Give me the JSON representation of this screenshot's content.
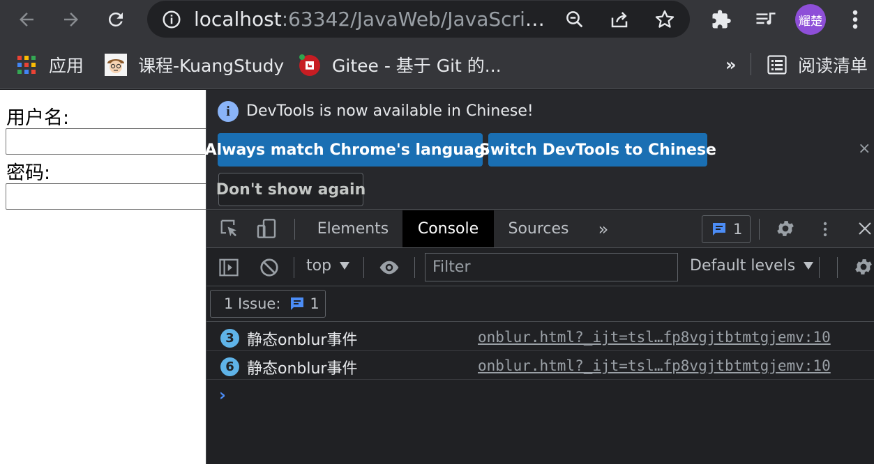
{
  "toolbar": {
    "url_host": "localhost",
    "url_path": ":63342/JavaWeb/JavaScript...",
    "avatar_text": "耀楚",
    "icons": [
      "back-icon",
      "forward-icon",
      "reload-icon",
      "site-info-icon",
      "zoom-icon",
      "share-icon",
      "bookmark-star-icon",
      "extensions-icon",
      "media-control-icon",
      "menu-icon"
    ]
  },
  "bookmarks": {
    "items": [
      {
        "label": "应用",
        "icon": "apps-grid-icon"
      },
      {
        "label": "课程-KuangStudy",
        "icon": "kuangstudy-favicon"
      },
      {
        "label": "Gitee - 基于 Git 的...",
        "icon": "gitee-favicon"
      }
    ],
    "overflow": "»",
    "reading_list": "阅读清单"
  },
  "page": {
    "username_label": "用户名:",
    "password_label": "密码:"
  },
  "devtools": {
    "infobar": {
      "message": "DevTools is now available in Chinese!",
      "btn_match": "Always match Chrome's language",
      "btn_switch": "Switch DevTools to Chinese",
      "btn_dont_show": "Don't show again",
      "close": "×"
    },
    "tabs": [
      "Elements",
      "Console",
      "Sources"
    ],
    "more_tabs": "»",
    "active_tab": "Console",
    "issues_badge_count": "1",
    "console": {
      "context": "top",
      "filter_placeholder": "Filter",
      "levels": "Default levels",
      "issues_label": "1 Issue:",
      "issues_count": "1",
      "rows": [
        {
          "count": "3",
          "message": "静态onblur事件",
          "source": "onblur.html?_ijt=tsl…fp8vgjtbtmtgjemv:10"
        },
        {
          "count": "6",
          "message": "静态onblur事件",
          "source": "onblur.html?_ijt=tsl…fp8vgjtbtmtgjemv:10"
        }
      ],
      "prompt": "›"
    }
  },
  "colors": {
    "chrome_bg": "#35363a",
    "devtools_bg": "#202124",
    "primary_button": "#1a6fb3",
    "accent_blue": "#8ab4f8",
    "avatar": "#8e4fd8"
  }
}
